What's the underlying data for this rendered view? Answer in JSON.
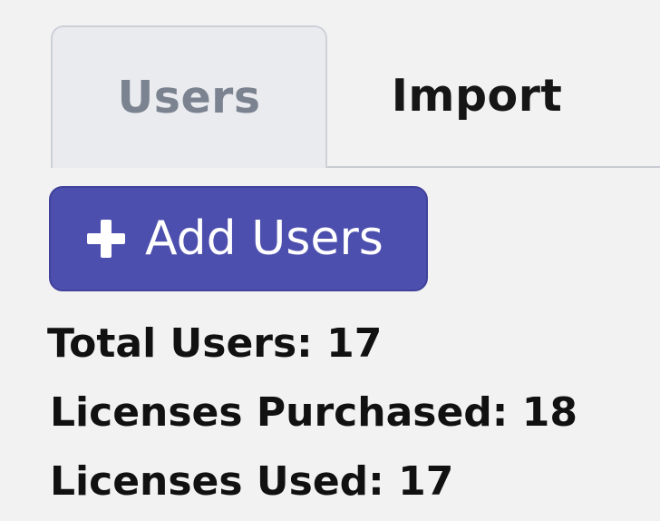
{
  "tabs": [
    {
      "label": "Users",
      "active": true
    },
    {
      "label": "Import",
      "active": false
    }
  ],
  "toolbar": {
    "add_users_label": "Add Users",
    "add_users_icon": "plus-icon",
    "accent_color": "#4d4fae"
  },
  "stats": {
    "total_users_label": "Total Users: 17",
    "licenses_purchased_label": "Licenses Purchased: 18",
    "licenses_used_label": "Licenses Used: 17"
  }
}
